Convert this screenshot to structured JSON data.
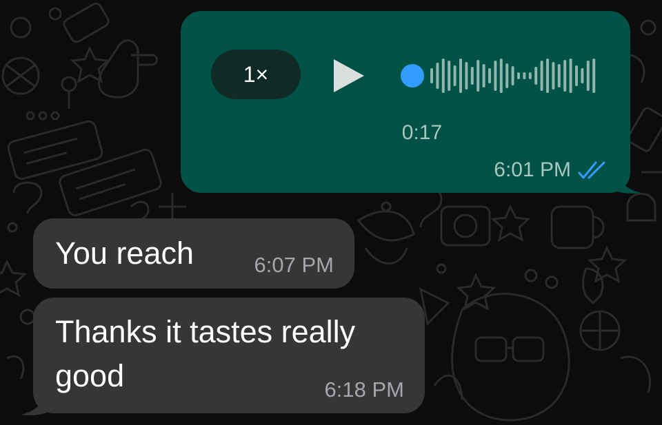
{
  "voice_message": {
    "speed": "1×",
    "duration": "0:17",
    "time": "6:01 PM",
    "progress": 0,
    "status": "read",
    "play_icon": "play-icon",
    "ticks_icon": "double-check-icon",
    "accent_color": "#339cff",
    "bubble_color": "#005246"
  },
  "incoming_messages": [
    {
      "text": "You reach",
      "time": "6:07 PM"
    },
    {
      "text": "Thanks it tastes really good",
      "time": "6:18 PM"
    }
  ],
  "colors": {
    "background": "#0c0c0c",
    "incoming_bubble": "#363638"
  }
}
